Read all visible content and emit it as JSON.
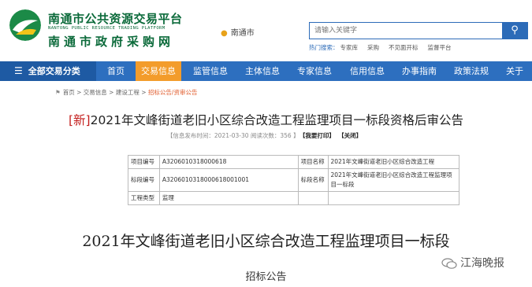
{
  "header": {
    "brand_cn": "南通市公共资源交易平台",
    "brand_en": "NANTONG PUBLIC RESOURCE TRADING PLATFORM",
    "brand_sub": "南通市政府采购网",
    "location": "南通市",
    "search_placeholder": "请输入关键字",
    "hot_label": "热门搜索：",
    "hot_items": [
      "专家库",
      "采购",
      "不见面开标",
      "监督平台"
    ]
  },
  "nav": {
    "all_label": "全部交易分类",
    "items": [
      "首页",
      "交易信息",
      "监管信息",
      "主体信息",
      "专家信息",
      "信用信息",
      "办事指南",
      "政策法规",
      "关于"
    ],
    "active_index": 1
  },
  "breadcrumb": [
    "首页",
    "交易信息",
    "建设工程",
    "招标公告/资审公告"
  ],
  "notice": {
    "tag": "[新]",
    "title": "2021年文峰街道老旧小区综合改造工程监理项目一标段资格后审公告",
    "meta": "【信息发布时间：2021-03-30 阅读次数：356 】",
    "print": "【我要打印】",
    "close": "【关闭】"
  },
  "table": {
    "rows": [
      [
        "项目编号",
        "A3206010318000618",
        "项目名称",
        "2021年文峰街道老旧小区综合改造工程"
      ],
      [
        "标段编号",
        "A3206010318000618001001",
        "标段名称",
        "2021年文峰街道老旧小区综合改造工程监理项目一标段"
      ],
      [
        "工程类型",
        "监理",
        "",
        ""
      ]
    ]
  },
  "body": {
    "heading": "2021年文峰街道老旧小区综合改造工程监理项目一标段",
    "subheading": "招标公告"
  },
  "watermark": "江海晚报",
  "colors": {
    "brand_green": "#0b6a3a",
    "nav_blue": "#2d6fbf",
    "active_orange": "#f39c2b",
    "new_red": "#c4201f"
  }
}
